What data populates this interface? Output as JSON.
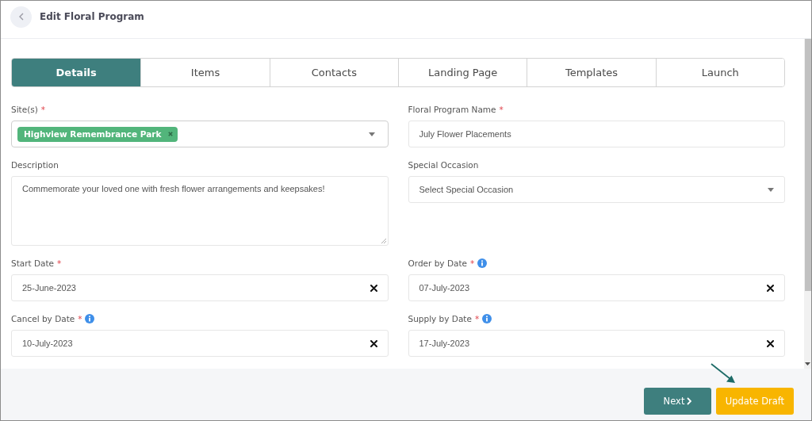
{
  "header": {
    "title": "Edit Floral Program"
  },
  "tabs": [
    {
      "label": "Details",
      "selected": true
    },
    {
      "label": "Items",
      "selected": false
    },
    {
      "label": "Contacts",
      "selected": false
    },
    {
      "label": "Landing Page",
      "selected": false
    },
    {
      "label": "Templates",
      "selected": false
    },
    {
      "label": "Launch",
      "selected": false
    }
  ],
  "form": {
    "fields": [
      {
        "kind": "multiselect",
        "label": "Site(s)",
        "required_mark": "*",
        "chips": [
          "Highview Remembrance Park"
        ]
      },
      {
        "kind": "text",
        "label": "Floral Program Name",
        "required_mark": "*",
        "value": "July Flower Placements"
      },
      {
        "kind": "textarea",
        "label": "Description",
        "value": "Commemorate your loved one with fresh flower arrangements and keepsakes!"
      },
      {
        "kind": "select",
        "label": "Special Occasion",
        "placeholder": "Select Special Occasion"
      },
      {
        "kind": "date",
        "label": "Start Date",
        "required_mark": "*",
        "value": "25-June-2023"
      },
      {
        "kind": "date",
        "label": "Order by Date",
        "required_mark": "*",
        "info": true,
        "value": "07-July-2023"
      },
      {
        "kind": "date",
        "label": "Cancel by Date",
        "required_mark": "*",
        "info": true,
        "value": "10-July-2023"
      },
      {
        "kind": "date",
        "label": "Supply by Date",
        "required_mark": "*",
        "info": true,
        "value": "17-July-2023"
      }
    ]
  },
  "footer": {
    "buttons": [
      {
        "kind": "next",
        "label": "Next"
      },
      {
        "kind": "primary",
        "label": "Update Draft"
      }
    ]
  }
}
